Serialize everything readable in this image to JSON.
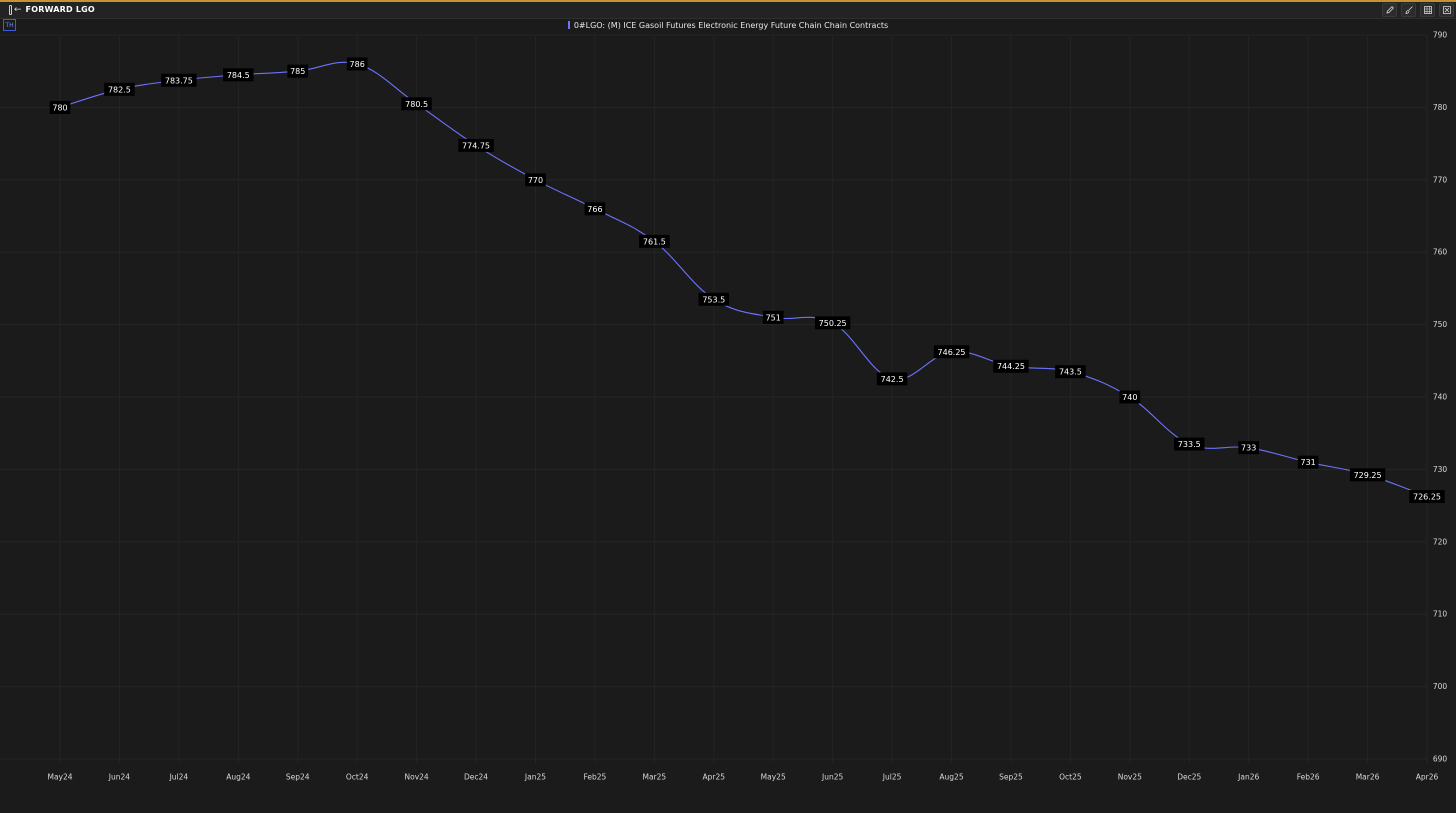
{
  "window": {
    "title": "FORWARD LGO",
    "badge": "TH"
  },
  "icons": {
    "panel_toggle": "panel-collapse-icon",
    "tools": [
      "pencil-icon",
      "brush-icon",
      "table-icon",
      "close-icon"
    ]
  },
  "colors": {
    "series": "#6b74ff",
    "background": "#1b1b1b",
    "accent": "#c8922e"
  },
  "chart_data": {
    "type": "line",
    "title": "",
    "xlabel": "",
    "ylabel": "",
    "ylim": [
      690,
      790
    ],
    "yticks": [
      690,
      700,
      710,
      720,
      730,
      740,
      750,
      760,
      770,
      780,
      790
    ],
    "grid": true,
    "legend_position": "top-center",
    "categories": [
      "May24",
      "Jun24",
      "Jul24",
      "Aug24",
      "Sep24",
      "Oct24",
      "Nov24",
      "Dec24",
      "Jan25",
      "Feb25",
      "Mar25",
      "Apr25",
      "May25",
      "Jun25",
      "Jul25",
      "Aug25",
      "Sep25",
      "Oct25",
      "Nov25",
      "Dec25",
      "Jan26",
      "Feb26",
      "Mar26",
      "Apr26"
    ],
    "series": [
      {
        "name": "0#LGO: (M) ICE Gasoil Futures Electronic Energy Future Chain Chain Contracts",
        "values": [
          780,
          782.5,
          783.75,
          784.5,
          785,
          786,
          780.5,
          774.75,
          770,
          766,
          761.5,
          753.5,
          751,
          750.25,
          742.5,
          746.25,
          744.25,
          743.5,
          740,
          733.5,
          733,
          731,
          729.25,
          726.25
        ]
      }
    ]
  }
}
